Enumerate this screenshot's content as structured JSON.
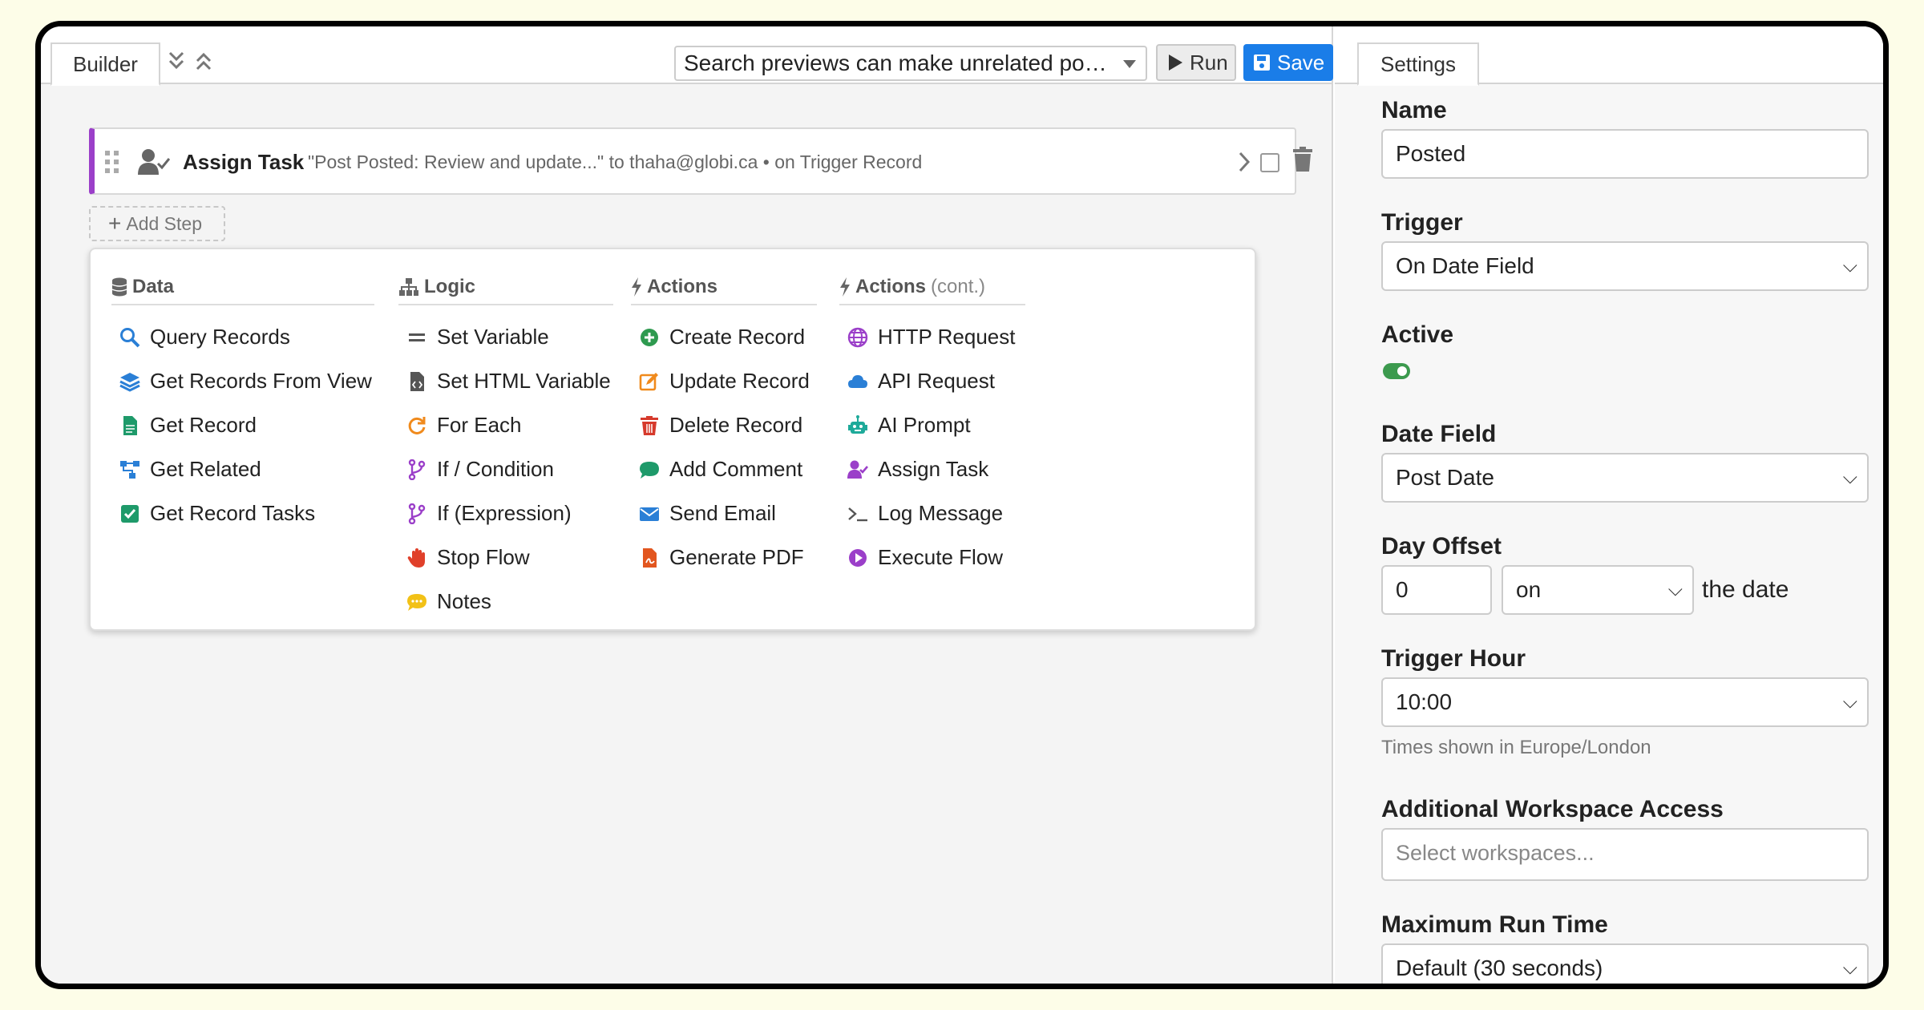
{
  "builder": {
    "tab_label": "Builder",
    "flow_select_value": "Search previews can make unrelated po…",
    "run_label": "Run",
    "save_label": "Save"
  },
  "step": {
    "title": "Assign Task",
    "description": "\"Post Posted: Review and update...\" to thaha@globi.ca • on Trigger Record"
  },
  "add_step_label": "Add Step",
  "menu": {
    "columns": [
      {
        "heading": "Data",
        "heading_note": "",
        "items": [
          "Query Records",
          "Get Records From View",
          "Get Record",
          "Get Related",
          "Get Record Tasks"
        ]
      },
      {
        "heading": "Logic",
        "heading_note": "",
        "items": [
          "Set Variable",
          "Set HTML Variable",
          "For Each",
          "If / Condition",
          "If (Expression)",
          "Stop Flow",
          "Notes"
        ]
      },
      {
        "heading": "Actions",
        "heading_note": "",
        "items": [
          "Create Record",
          "Update Record",
          "Delete Record",
          "Add Comment",
          "Send Email",
          "Generate PDF"
        ]
      },
      {
        "heading": "Actions",
        "heading_note": "(cont.)",
        "items": [
          "HTTP Request",
          "API Request",
          "AI Prompt",
          "Assign Task",
          "Log Message",
          "Execute Flow"
        ]
      }
    ]
  },
  "settings": {
    "tab_label": "Settings",
    "name_label": "Name",
    "name_value": "Posted",
    "trigger_label": "Trigger",
    "trigger_value": "On Date Field",
    "active_label": "Active",
    "date_field_label": "Date Field",
    "date_field_value": "Post Date",
    "day_offset_label": "Day Offset",
    "day_offset_value": "0",
    "day_offset_relation": "on",
    "day_offset_suffix": "the date",
    "trigger_hour_label": "Trigger Hour",
    "trigger_hour_value": "10:00",
    "timezone_help": "Times shown in Europe/London",
    "workspace_label": "Additional Workspace Access",
    "workspace_placeholder": "Select workspaces...",
    "max_run_label": "Maximum Run Time",
    "max_run_value": "Default (30 seconds)"
  },
  "colors": {
    "accent_purple": "#9b3fc9",
    "save_blue": "#1a7de8",
    "toggle_green": "#3c9a4e"
  }
}
